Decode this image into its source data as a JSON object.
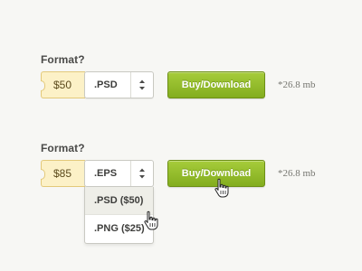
{
  "form_1": {
    "format_label": "Format?",
    "price": "$50",
    "selected_format": ".PSD",
    "button_label": "Buy/Download",
    "file_size": "*26.8 mb"
  },
  "form_2": {
    "format_label": "Format?",
    "price": "$85",
    "selected_format": ".EPS",
    "button_label": "Buy/Download",
    "file_size": "*26.8 mb",
    "dropdown_open": true,
    "dropdown_options": [
      ".PSD  ($50)",
      ".PNG  ($25)"
    ],
    "hovered_option_index": 0
  },
  "icons": {
    "select_arrows": "up-down-arrows-icon",
    "hand_cursor": "hand-pointer-cursor-icon"
  },
  "colors": {
    "background": "#f7f7f4",
    "button_green": "#92ba2b",
    "price_tag_fill": "#fcf1c7",
    "price_tag_border": "#e3c97a",
    "hover_highlight": "#eeeee8"
  }
}
